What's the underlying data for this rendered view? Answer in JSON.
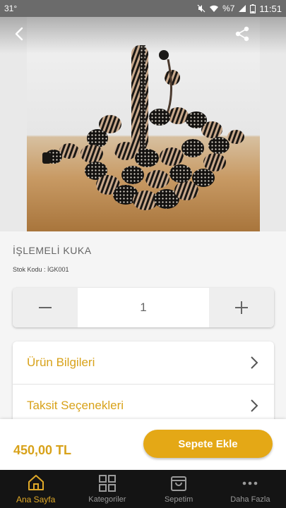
{
  "status_bar": {
    "temperature": "31°",
    "battery": "%7",
    "time": "11:51"
  },
  "product": {
    "name": "İŞLEMELİ KUKA",
    "sku_label": "Stok Kodu : İGK001",
    "quantity": "1",
    "price": "450,00 TL"
  },
  "info_rows": [
    {
      "label": "Ürün Bilgileri"
    },
    {
      "label": "Taksit Seçenekleri"
    }
  ],
  "actions": {
    "add_to_cart": "Sepete Ekle"
  },
  "nav": {
    "items": [
      {
        "label": "Ana Sayfa",
        "icon": "home-icon",
        "active": true
      },
      {
        "label": "Kategoriler",
        "icon": "grid-icon",
        "active": false
      },
      {
        "label": "Sepetim",
        "icon": "bag-icon",
        "active": false
      },
      {
        "label": "Daha Fazla",
        "icon": "more-icon",
        "active": false
      }
    ]
  },
  "colors": {
    "accent": "#e4a816",
    "accent_text": "#d8a21a",
    "nav_bg": "#141414"
  }
}
